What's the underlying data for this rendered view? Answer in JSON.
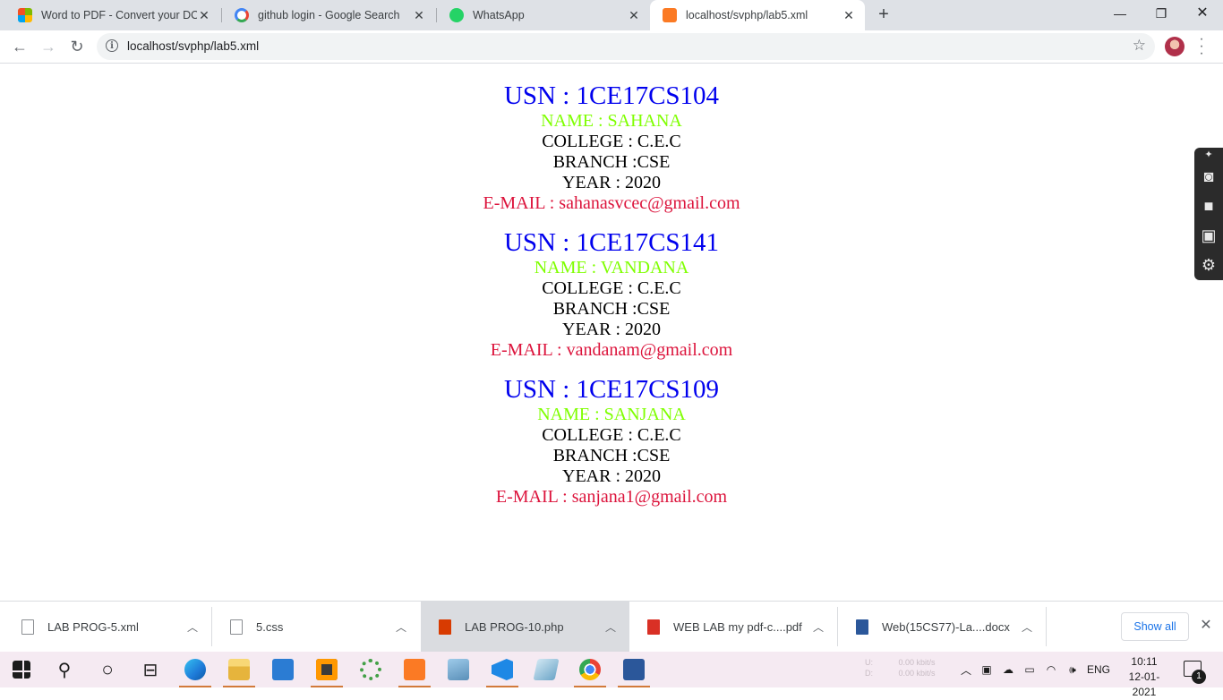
{
  "browser": {
    "tabs": [
      {
        "title": "Word to PDF - Convert your DOC",
        "favicon": "colorful-grid-icon",
        "active": false
      },
      {
        "title": "github login - Google Search",
        "favicon": "google-icon",
        "active": false
      },
      {
        "title": "WhatsApp",
        "favicon": "whatsapp-icon",
        "active": false
      },
      {
        "title": "localhost/svphp/lab5.xml",
        "favicon": "xampp-icon",
        "active": true
      }
    ],
    "url": "localhost/svphp/lab5.xml"
  },
  "records": [
    {
      "usn": "USN : 1CE17CS104",
      "name": "NAME : SAHANA",
      "college": "COLLEGE : C.E.C",
      "branch": "BRANCH :CSE",
      "year": "YEAR : 2020",
      "email": "E-MAIL : sahanasvcec@gmail.com"
    },
    {
      "usn": "USN : 1CE17CS141",
      "name": "NAME : VANDANA",
      "college": "COLLEGE : C.E.C",
      "branch": "BRANCH :CSE",
      "year": "YEAR : 2020",
      "email": "E-MAIL : vandanam@gmail.com"
    },
    {
      "usn": "USN : 1CE17CS109",
      "name": "NAME : SANJANA",
      "college": "COLLEGE : C.E.C",
      "branch": "BRANCH :CSE",
      "year": "YEAR : 2020",
      "email": "E-MAIL : sanjana1@gmail.com"
    }
  ],
  "colors": {
    "usn": "#0000ee",
    "name": "#7fff00",
    "email": "#dc143c"
  },
  "downloads": {
    "items": [
      {
        "name": "LAB PROG-5.xml",
        "icon": "file-icon"
      },
      {
        "name": "5.css",
        "icon": "file-icon"
      },
      {
        "name": "LAB PROG-10.php",
        "icon": "office-icon"
      },
      {
        "name": "WEB LAB my pdf-c....pdf",
        "icon": "pdf-icon"
      },
      {
        "name": "Web(15CS77)-La....docx",
        "icon": "word-icon"
      }
    ],
    "show_all": "Show all"
  },
  "taskbar": {
    "net_up": "U:",
    "net_down": "D:",
    "net_up_speed": "0.00 kbit/s",
    "net_down_speed": "0.00 kbit/s",
    "language": "ENG",
    "time": "10:11",
    "date": "12-01-2021",
    "notifications": "1"
  }
}
